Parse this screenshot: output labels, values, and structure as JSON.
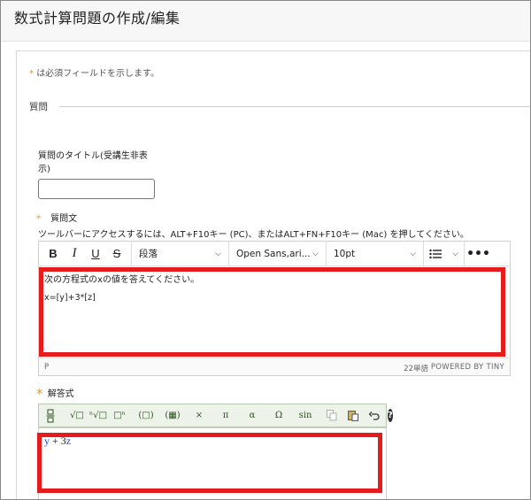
{
  "page": {
    "title": "数式計算問題の作成/編集"
  },
  "form": {
    "required_star": "*",
    "required_note": "は必須フィールドを示します。",
    "section_label": "質問",
    "title_field": {
      "label": "質問のタイトル(受講生非表示)",
      "value": ""
    },
    "question_field": {
      "label": "質問文",
      "toolbar_hint": "ツールバーにアクセスするには、ALT+F10キー (PC)、またはALT+FN+F10キー (Mac) を押してください。"
    },
    "answer_field": {
      "label": "解答式"
    }
  },
  "editor": {
    "toolbar": {
      "bold": "B",
      "italic": "I",
      "underline": "U",
      "strike": "S",
      "format": "段落",
      "font": "Open Sans,ari...",
      "size": "10pt",
      "more": "•••"
    },
    "content": {
      "line1": "次の方程式のxの値を答えてください。",
      "line2": "x=[y]+3*[z]"
    },
    "status": {
      "path": "P",
      "words": "22単語",
      "powered": "POWERED BY TINY"
    }
  },
  "math_editor": {
    "buttons": {
      "fraction": "⁄",
      "sqrt": "√□",
      "nroot": "ⁿ√□",
      "superscript": "□ⁿ",
      "parens": "(□)",
      "matrix": "(▦)",
      "times": "×",
      "pi": "π",
      "alpha": "α",
      "omega": "Ω",
      "sin": "sin",
      "help": "?"
    },
    "expression": {
      "var1": "y",
      "op": " + 3",
      "var2": "z"
    }
  },
  "colors": {
    "highlight": "#e61b1b",
    "required_star": "#e59a1f",
    "math_variable": "#1a3fd6"
  }
}
